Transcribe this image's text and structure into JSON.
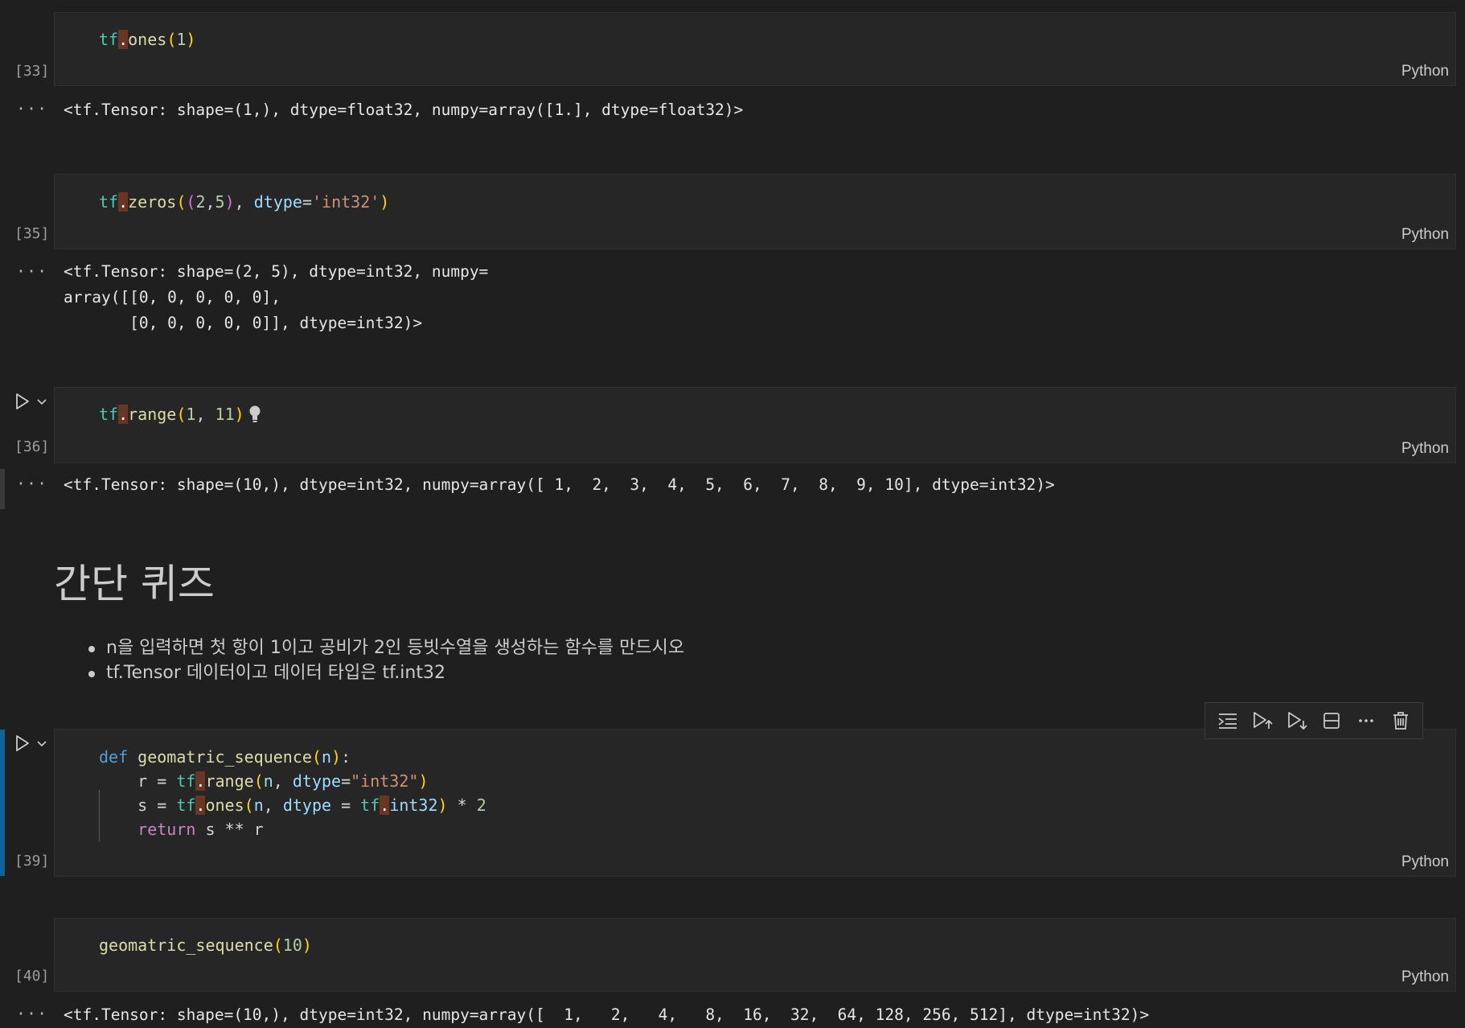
{
  "language_label": "Python",
  "output_dots": "···",
  "cells": {
    "c33": {
      "exec_count": "[33]",
      "line1": {
        "tf": "tf",
        "dot": ".",
        "fn": "ones",
        "p1": "(",
        "n1": "1",
        "p2": ")"
      },
      "output": "<tf.Tensor: shape=(1,), dtype=float32, numpy=array([1.], dtype=float32)>"
    },
    "c35": {
      "exec_count": "[35]",
      "line1": {
        "tf": "tf",
        "dot": ".",
        "fn": "zeros",
        "p1": "(",
        "p2": "(",
        "n1": "2",
        "comma1": ",",
        "n2": "5",
        "p3": ")",
        "comma2": ", ",
        "prm": "dtype",
        "eq": "=",
        "str": "'int32'",
        "p4": ")"
      },
      "output_lines": [
        "<tf.Tensor: shape=(2, 5), dtype=int32, numpy=",
        "array([[0, 0, 0, 0, 0],",
        "       [0, 0, 0, 0, 0]], dtype=int32)>"
      ]
    },
    "c36": {
      "exec_count": "[36]",
      "line1": {
        "tf": "tf",
        "dot": ".",
        "fn": "range",
        "p1": "(",
        "n1": "1",
        "comma": ", ",
        "n2": "11",
        "p2": ")"
      },
      "output": "<tf.Tensor: shape=(10,), dtype=int32, numpy=array([ 1,  2,  3,  4,  5,  6,  7,  8,  9, 10], dtype=int32)>"
    },
    "c39": {
      "exec_count": "[39]",
      "l1": {
        "def": "def",
        "fn": "geomatric_sequence",
        "p1": "(",
        "prm": "n",
        "p2": ")",
        "colon": ":"
      },
      "l2": {
        "lhs": "    r = ",
        "tf": "tf",
        "dot": ".",
        "fn": "range",
        "p1": "(",
        "prm": "n",
        "comma": ", ",
        "prm2": "dtype",
        "eq": "=",
        "str": "\"int32\"",
        "p2": ")"
      },
      "l3": {
        "lhs": "    s = ",
        "tf": "tf",
        "dot": ".",
        "fn": "ones",
        "p1": "(",
        "prm": "n",
        "comma": ", ",
        "prm2": "dtype",
        "eq": " = ",
        "tf2": "tf",
        "dot2": ".",
        "attr": "int32",
        "p2": ")",
        "op": " * ",
        "num": "2"
      },
      "l4": {
        "indent": "    ",
        "kw": "return",
        "rest": " s ** r"
      }
    },
    "c40": {
      "exec_count": "[40]",
      "line1": {
        "fn": "geomatric_sequence",
        "p1": "(",
        "n1": "10",
        "p2": ")"
      },
      "output": "<tf.Tensor: shape=(10,), dtype=int32, numpy=array([  1,   2,   4,   8,  16,  32,  64, 128, 256, 512], dtype=int32)>"
    }
  },
  "markdown": {
    "heading": "간단 퀴즈",
    "bullets": [
      "n을 입력하면 첫 항이 1이고 공비가 2인 등빗수열을 생성하는 함수를 만드시오",
      "tf.Tensor 데이터이고 데이터 타입은 tf.int32"
    ]
  },
  "toolbar_icons": [
    "execute-above-icon",
    "run-above-icon",
    "run-below-icon",
    "split-cell-icon",
    "more-actions-icon",
    "delete-icon"
  ]
}
